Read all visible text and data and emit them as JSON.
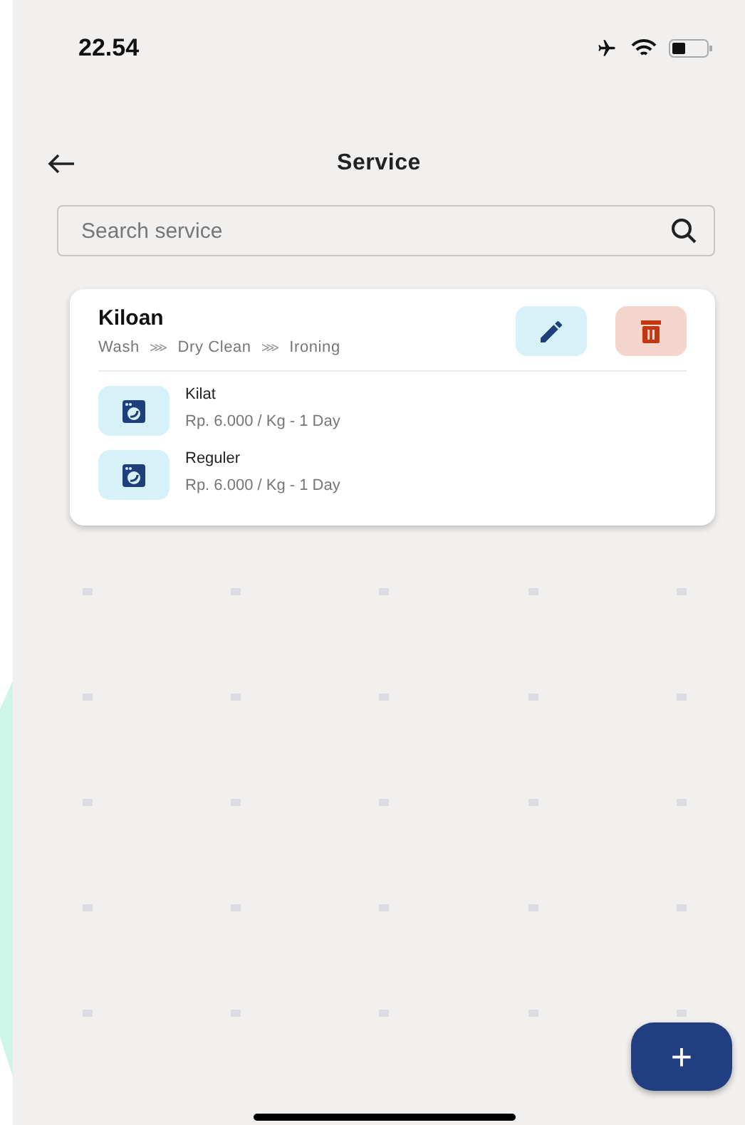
{
  "status_bar": {
    "time": "22.54"
  },
  "header": {
    "title": "Service"
  },
  "search": {
    "placeholder": "Search service"
  },
  "groups": [
    {
      "name": "Kiloan",
      "steps": [
        "Wash",
        "Dry Clean",
        "Ironing"
      ],
      "separator": "⋙",
      "services": [
        {
          "name": "Kilat",
          "price": "Rp. 6.000 / Kg - 1 Day"
        },
        {
          "name": "Reguler",
          "price": "Rp. 6.000 / Kg - 1 Day"
        }
      ]
    }
  ],
  "fab": {
    "label": "+"
  }
}
